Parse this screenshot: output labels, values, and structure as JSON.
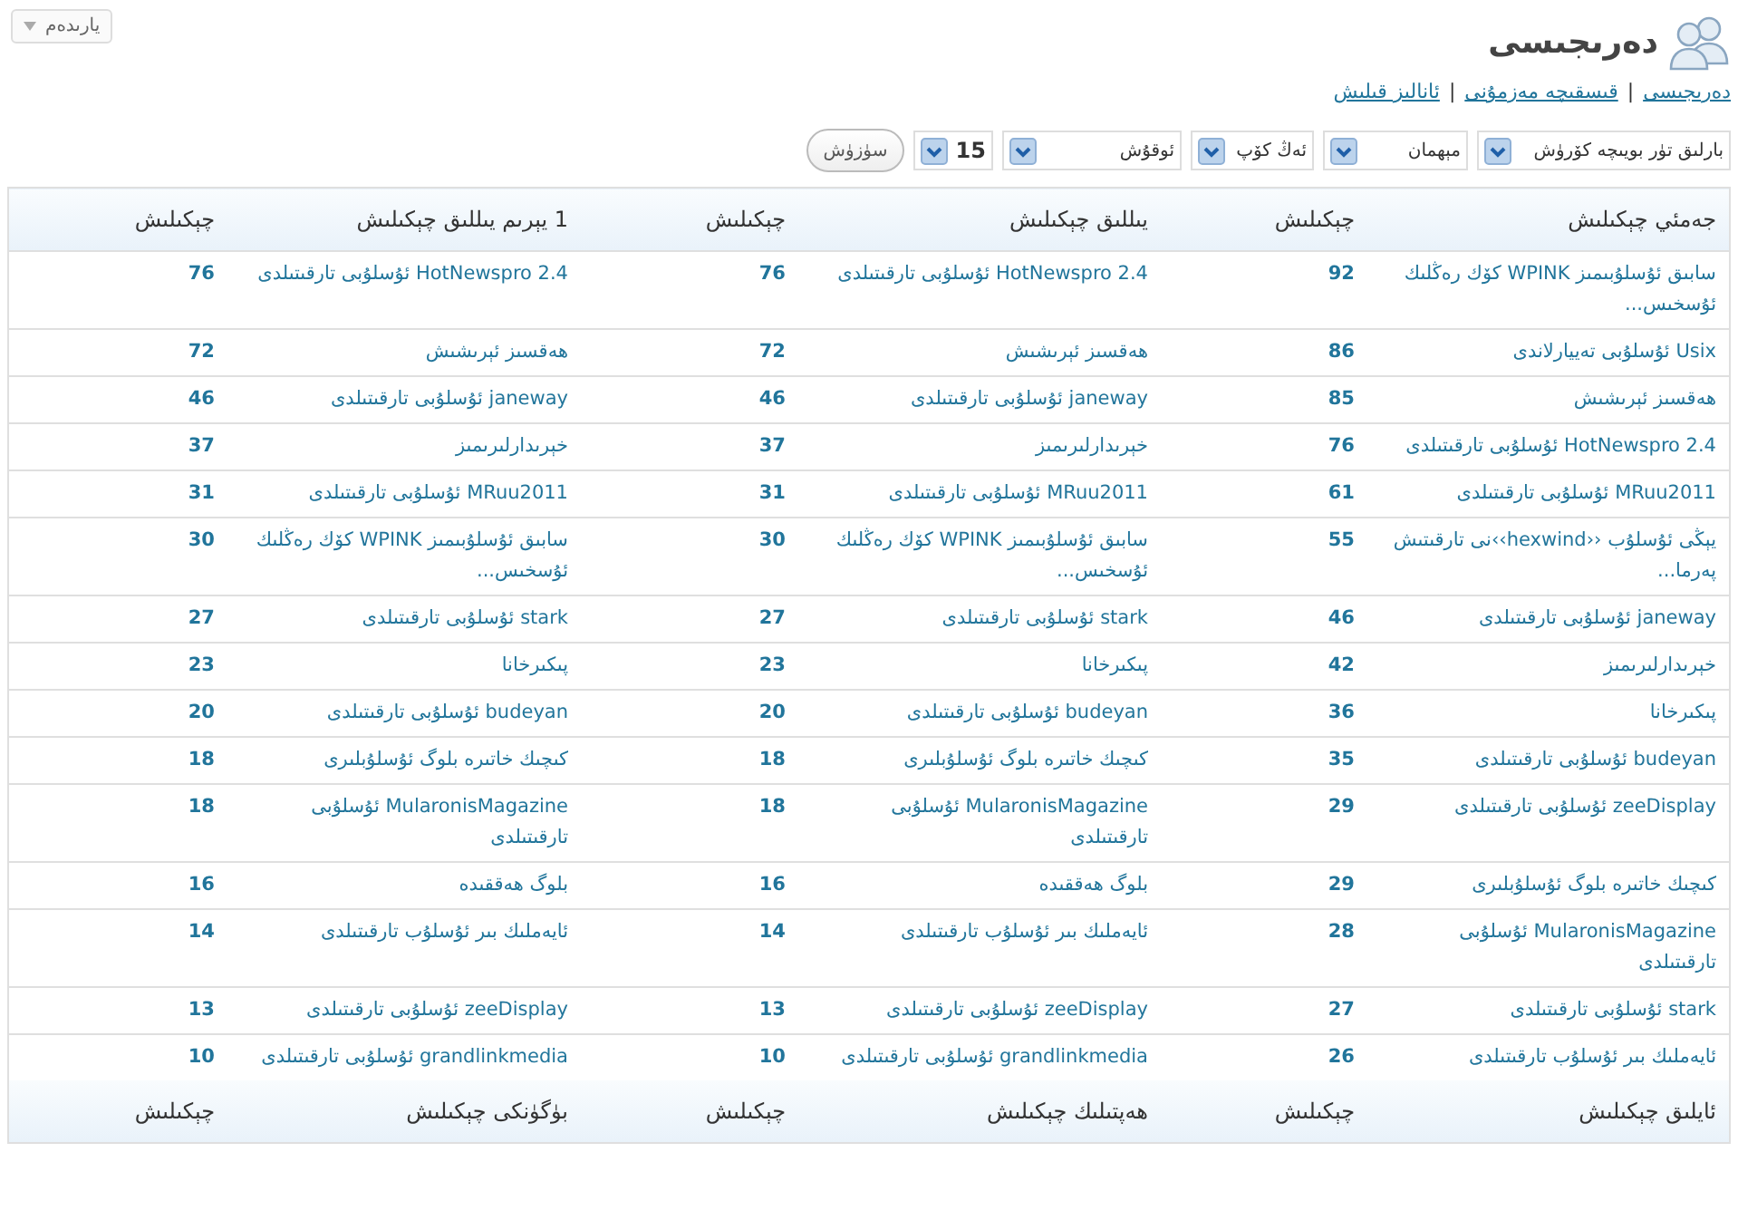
{
  "help_button": {
    "label": "يارىدەم"
  },
  "page_title": "دەرىجىسى",
  "nav_links": [
    {
      "label": "دەرىجىسى"
    },
    {
      "label": "قىسقىچە مەزمۇنى"
    },
    {
      "label": "ئانالىز قىلىش"
    }
  ],
  "nav_separators": [
    "|",
    "|"
  ],
  "filters": [
    {
      "value": "بارلىق تۈر بويىچە كۆرۈش"
    },
    {
      "value": "مېھمان"
    },
    {
      "value": "ئەڭ كۆپ"
    },
    {
      "value": "ئوقۇش"
    },
    {
      "value": "15"
    }
  ],
  "filter_button": "سۈزۈش",
  "table": {
    "columns": [
      "جەمئي چېكىلىش",
      "چېكىلىش",
      "يىللىق چېكىلىش",
      "چېكىلىش",
      "1 يېرىم يىللىق چېكىلىش",
      "چېكىلىش"
    ],
    "rows": [
      [
        "سابىق ئۇسلۇبىمىز WPINK كۆك رەڭلىك ئۇسخىس...",
        "92",
        "HotNewspro 2.4 ئۇسلۇبى تارقىتىلدى",
        "76",
        "HotNewspro 2.4 ئۇسلۇبى تارقىتىلدى",
        "76"
      ],
      [
        "Usix ئۇسلۇبى تەييارلاندى",
        "86",
        "ھەقسىز ئېرىشىش",
        "72",
        "ھەقسىز ئېرىشىش",
        "72"
      ],
      [
        "ھەقسىز ئېرىشىش",
        "85",
        "janeway ئۇسلۇبى تارقىتىلدى",
        "46",
        "janeway ئۇسلۇبى تارقىتىلدى",
        "46"
      ],
      [
        "HotNewspro 2.4 ئۇسلۇبى تارقىتىلدى",
        "76",
        "خېرىدارلىرىمىز",
        "37",
        "خېرىدارلىرىمىز",
        "37"
      ],
      [
        "MRuu2011 ئۇسلۇبى تارقىتىلدى",
        "61",
        "MRuu2011 ئۇسلۇبى تارقىتىلدى",
        "31",
        "MRuu2011 ئۇسلۇبى تارقىتىلدى",
        "31"
      ],
      [
        "يېڭى ئۇسلۇب ‹‹hexwind››نى تارقىتىش پەرما...",
        "55",
        "سابىق ئۇسلۇبىمىز WPINK كۆك رەڭلىك ئۇسخىس...",
        "30",
        "سابىق ئۇسلۇبىمىز WPINK كۆك رەڭلىك ئۇسخىس...",
        "30"
      ],
      [
        "janeway ئۇسلۇبى تارقىتىلدى",
        "46",
        "stark ئۇسلۇبى تارقىتىلدى",
        "27",
        "stark ئۇسلۇبى تارقىتىلدى",
        "27"
      ],
      [
        "خېرىدارلىرىمىز",
        "42",
        "پىكىرخانا",
        "23",
        "پىكىرخانا",
        "23"
      ],
      [
        "پىكىرخانا",
        "36",
        "budeyan ئۇسلۇبى تارقىتىلدى",
        "20",
        "budeyan ئۇسلۇبى تارقىتىلدى",
        "20"
      ],
      [
        "budeyan ئۇسلۇبى تارقىتىلدى",
        "35",
        "كىچىك خاتىرە بلوگ ئۇسلۇبلىرى",
        "18",
        "كىچىك خاتىرە بلوگ ئۇسلۇبلىرى",
        "18"
      ],
      [
        "zeeDisplay ئۇسلۇبى تارقىتىلدى",
        "29",
        "MularonisMagazine ئۇسلۇبى تارقىتىلدى",
        "18",
        "MularonisMagazine ئۇسلۇبى تارقىتىلدى",
        "18"
      ],
      [
        "كىچىك خاتىرە بلوگ ئۇسلۇبلىرى",
        "29",
        "بلوگ ھەققىدە",
        "16",
        "بلوگ ھەققىدە",
        "16"
      ],
      [
        "MularonisMagazine ئۇسلۇبى تارقىتىلدى",
        "28",
        "ئايەملىك بىر ئۇسلۇب تارقىتىلدى",
        "14",
        "ئايەملىك بىر ئۇسلۇب تارقىتىلدى",
        "14"
      ],
      [
        "stark ئۇسلۇبى تارقىتىلدى",
        "27",
        "zeeDisplay ئۇسلۇبى تارقىتىلدى",
        "13",
        "zeeDisplay ئۇسلۇبى تارقىتىلدى",
        "13"
      ],
      [
        "ئايەملىك بىر ئۇسلۇب تارقىتىلدى",
        "26",
        "grandlinkmedia ئۇسلۇبى تارقىتىلدى",
        "10",
        "grandlinkmedia ئۇسلۇبى تارقىتىلدى",
        "10"
      ]
    ],
    "footer_columns": [
      "ئايلىق چېكىلىش",
      "چېكىلىش",
      "ھەپتىلىك چېكىلىش",
      "چېكىلىش",
      "بۈگۈنكى چېكىلىش",
      "چېكىلىش"
    ]
  }
}
